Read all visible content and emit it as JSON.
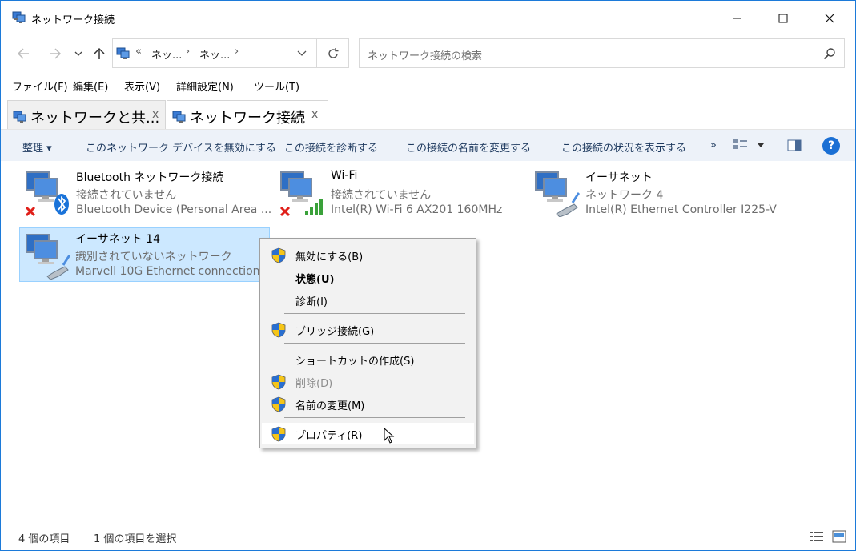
{
  "window": {
    "title": "ネットワーク接続"
  },
  "address": {
    "prefix": "«",
    "crumbs": [
      "ネッ...",
      "ネッ..."
    ],
    "separator": "›"
  },
  "search": {
    "placeholder": "ネットワーク接続の検索"
  },
  "menubar": {
    "items": [
      "ファイル(F)",
      "編集(E)",
      "表示(V)",
      "詳細設定(N)",
      "ツール(T)"
    ]
  },
  "tabs": [
    {
      "label": "ネットワークと共...",
      "close": "x",
      "active": false
    },
    {
      "label": "ネットワーク接続",
      "close": "x",
      "active": true
    }
  ],
  "commandbar": {
    "organize": "整理 ▾",
    "items": [
      "このネットワーク デバイスを無効にする",
      "この接続を診断する",
      "この接続の名前を変更する",
      "この接続の状況を表示する"
    ],
    "more": "»",
    "help": "?"
  },
  "connections": [
    {
      "name": "Bluetooth ネットワーク接続",
      "status": "接続されていません",
      "device": "Bluetooth Device (Personal Area ...",
      "icon": "bluetooth-adapter-icon",
      "disconnected": true,
      "selected": false
    },
    {
      "name": "Wi-Fi",
      "status": "接続されていません",
      "device": "Intel(R) Wi-Fi 6 AX201 160MHz",
      "icon": "wifi-adapter-icon",
      "disconnected": true,
      "selected": false
    },
    {
      "name": "イーサネット",
      "status": "ネットワーク 4",
      "device": "Intel(R) Ethernet Controller I225-V",
      "icon": "ethernet-adapter-icon",
      "disconnected": false,
      "selected": false
    },
    {
      "name": "イーサネット 14",
      "status": "識別されていないネットワーク",
      "device": "Marvell 10G Ethernet connection",
      "icon": "ethernet-adapter-icon",
      "disconnected": false,
      "selected": true
    }
  ],
  "context_menu": {
    "items": [
      {
        "label": "無効にする(B)",
        "shield": true,
        "bold": false,
        "disabled": false
      },
      {
        "label": "状態(U)",
        "shield": false,
        "bold": true,
        "disabled": false
      },
      {
        "label": "診断(I)",
        "shield": false,
        "bold": false,
        "disabled": false
      },
      {
        "label": "ブリッジ接続(G)",
        "shield": true,
        "bold": false,
        "disabled": false
      },
      {
        "label": "ショートカットの作成(S)",
        "shield": false,
        "bold": false,
        "disabled": false
      },
      {
        "label": "削除(D)",
        "shield": true,
        "bold": false,
        "disabled": true
      },
      {
        "label": "名前の変更(M)",
        "shield": true,
        "bold": false,
        "disabled": false
      },
      {
        "label": "プロパティ(R)",
        "shield": true,
        "bold": false,
        "disabled": false,
        "hovered": true
      }
    ]
  },
  "statusbar": {
    "count": "4 個の項目",
    "selected": "1 個の項目を選択"
  },
  "colors": {
    "accent": "#1c7ad9",
    "selection": "#cce8ff",
    "commandbar": "#edf2f9",
    "help": "#1a6fd4"
  }
}
